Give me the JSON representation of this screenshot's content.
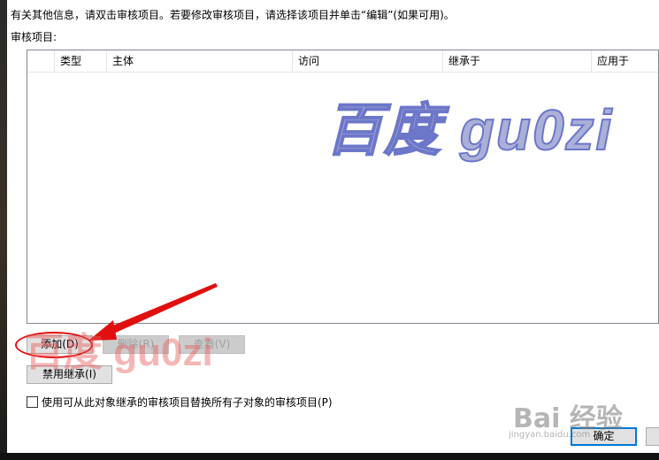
{
  "dialog": {
    "info_text": "有关其他信息，请双击审核项目。若要修改审核项目，请选择该项目并单击“编辑”(如果可用)。",
    "list_label": "审核项目:"
  },
  "table": {
    "columns": [
      "类型",
      "主体",
      "访问",
      "继承于",
      "应用于"
    ],
    "rows": []
  },
  "buttons": {
    "add": "添加(D)",
    "remove": "删除(R)",
    "view": "查看(V)",
    "disable_inheritance": "禁用继承(I)",
    "ok": "确定"
  },
  "checkbox": {
    "label": "使用可从此对象继承的审核项目替换所有子对象的审核项目(P)",
    "checked": false
  },
  "watermarks": {
    "large": "百度 gu0zi",
    "small": "百度 gu0zi",
    "corner": "Bai 经验",
    "corner_sub": "jingyan.baidu.com"
  },
  "annotations": {
    "highlight_color": "#e01010"
  }
}
